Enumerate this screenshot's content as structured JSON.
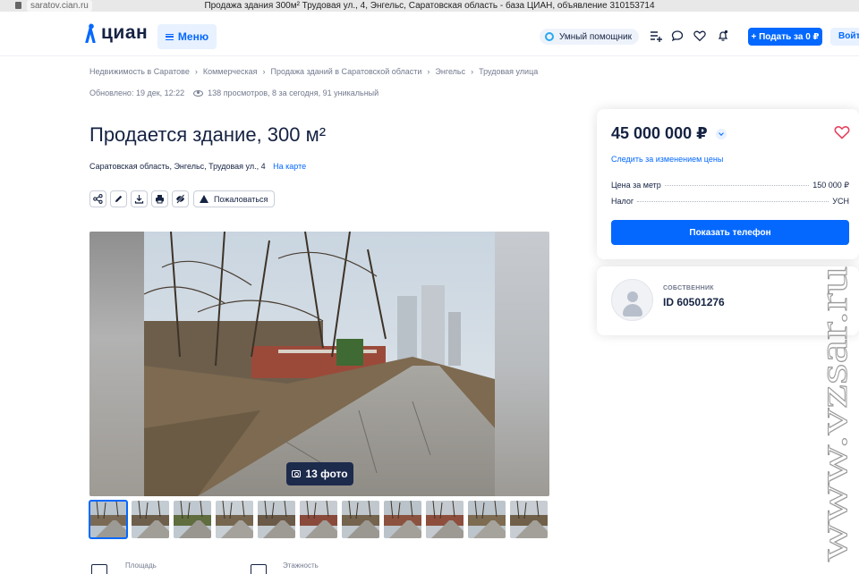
{
  "browser": {
    "url": "saratov.cian.ru",
    "tab_title": "Продажа здания 300м² Трудовая ул., 4, Энгельс, Саратовская область - база ЦИАН, объявление 310153714"
  },
  "header": {
    "logo_text": "циан",
    "menu_label": "Меню",
    "assistant_label": "Умный помощник",
    "post_button": "+ Подать за 0 ₽",
    "login_button": "Войти",
    "icons": [
      "compare-icon",
      "chat-icon",
      "favorites-icon",
      "notifications-icon"
    ]
  },
  "breadcrumbs": [
    "Недвижимость в Саратове",
    "Коммерческая",
    "Продажа зданий в Саратовской области",
    "Энгельс",
    "Трудовая улица"
  ],
  "meta": {
    "updated": "Обновлено: 19 дек, 12:22",
    "views": "138 просмотров, 8 за сегодня, 91 уникальный"
  },
  "listing": {
    "title": "Продается здание, 300 м²",
    "address": "Саратовская область, Энгельс, Трудовая ул., 4",
    "map_link": "На карте",
    "complain_label": "Пожаловаться",
    "toolbar_icons": [
      "share-icon",
      "edit-icon",
      "download-icon",
      "print-icon",
      "hide-icon"
    ],
    "photo_count": "13 фото",
    "thumbnails": 11,
    "features": [
      {
        "label": "Площадь",
        "icon": "area-icon"
      },
      {
        "label": "Этажность",
        "icon": "floors-icon"
      }
    ]
  },
  "price_card": {
    "price": "45 000 000 ₽",
    "watch_link": "Следить за изменением цены",
    "rows": [
      {
        "label": "Цена за метр",
        "value": "150 000 ₽"
      },
      {
        "label": "Налог",
        "value": "УСН"
      }
    ],
    "phone_button": "Показать телефон"
  },
  "owner_card": {
    "role": "СОБСТВЕННИК",
    "id": "ID 60501276"
  },
  "watermark": "www.vzsar.ru",
  "colors": {
    "brand_blue": "#0468ff",
    "text_dark": "#152242",
    "text_muted": "#737a8e",
    "favorite_red": "#e84260"
  }
}
